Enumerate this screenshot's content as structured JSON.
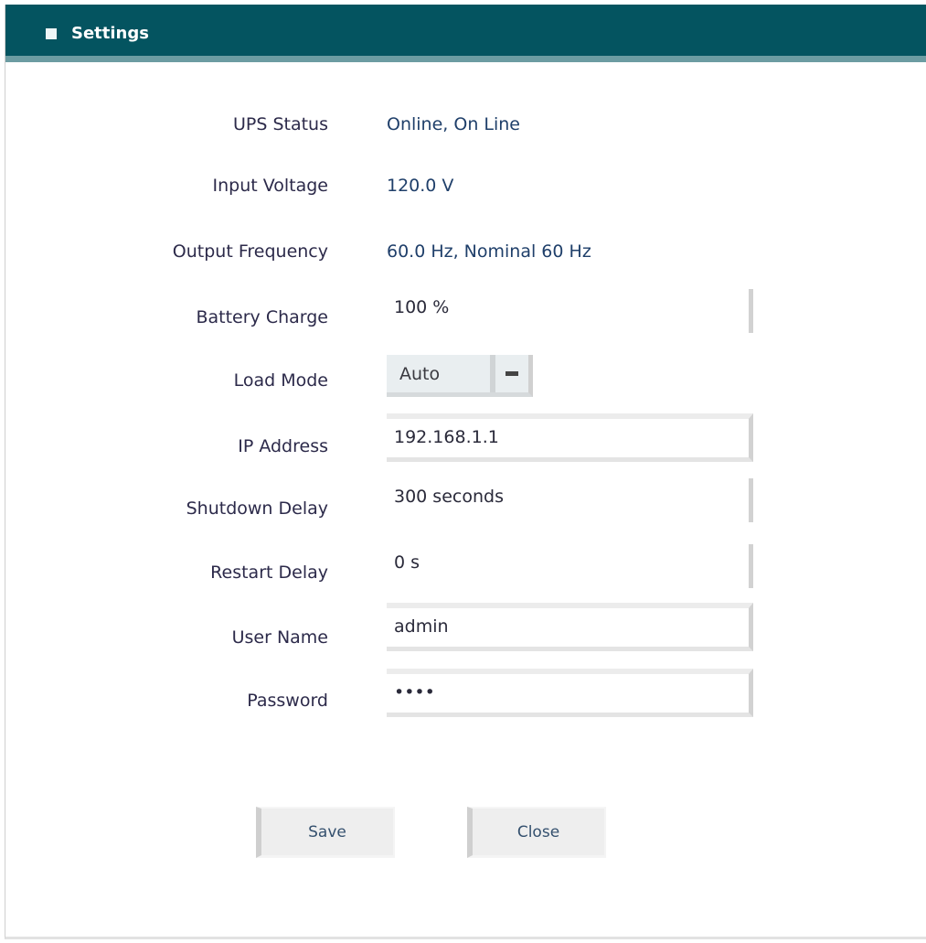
{
  "window": {
    "title": "Settings",
    "icon": "app-icon"
  },
  "fields": [
    {
      "label": "UPS Status",
      "value": "Online, On Line",
      "kind": "text"
    },
    {
      "label": "Input Voltage",
      "value": "120.0 V",
      "kind": "text"
    },
    {
      "label": "Output Frequency",
      "value": "60.0 Hz, Nominal 60 Hz",
      "kind": "text"
    },
    {
      "label": "Battery Charge",
      "value": "100 %",
      "kind": "input-flat"
    },
    {
      "label": "Load Mode",
      "value": "Auto",
      "kind": "combo"
    },
    {
      "label": "IP Address",
      "value": "192.168.1.1",
      "kind": "input"
    },
    {
      "label": "Shutdown Delay",
      "value": "300 seconds",
      "kind": "input-flat"
    },
    {
      "label": "Restart Delay",
      "value": "0 s",
      "kind": "input-flat"
    },
    {
      "label": "User Name",
      "value": "admin",
      "kind": "input"
    },
    {
      "label": "Password",
      "value": "••••",
      "kind": "input"
    }
  ],
  "buttons": {
    "ok": "Save",
    "cancel": "Close"
  },
  "colors": {
    "titlebar": "#045460",
    "titlebar_stripe": "#6c9ca2",
    "accent": "#2a6aa8"
  }
}
